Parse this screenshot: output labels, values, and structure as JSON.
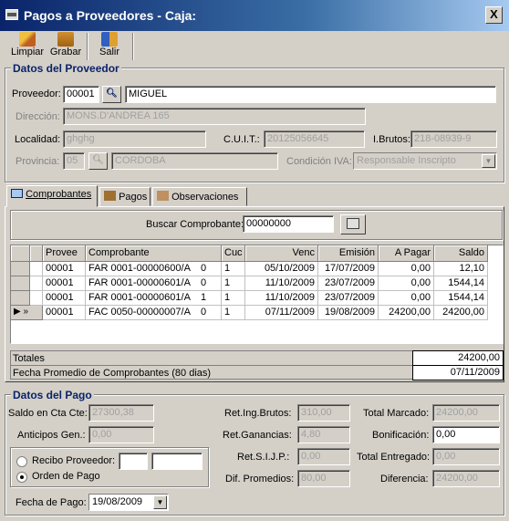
{
  "window": {
    "title": "Pagos a Proveedores - Caja:",
    "close": "X"
  },
  "toolbar": {
    "limpiar": "Limpiar",
    "grabar": "Grabar",
    "salir": "Salir"
  },
  "proveedor": {
    "legend": "Datos del Proveedor",
    "proveedor_label": "Proveedor:",
    "codigo": "00001",
    "nombre": "MIGUEL",
    "direccion_label": "Dirección:",
    "direccion": "MONS.D'ANDREA 165",
    "localidad_label": "Localidad:",
    "localidad": "ghghg",
    "cuit_label": "C.U.I.T.:",
    "cuit": "20125056645",
    "ibrutos_label": "I.Brutos:",
    "ibrutos": "218-08939-9",
    "provincia_label": "Provincia:",
    "provincia_cod": "05",
    "provincia": "CORDOBA",
    "condicion_label": "Condición IVA:",
    "condicion": "Responsable Inscripto"
  },
  "tabs": [
    "Comprobantes",
    "Pagos",
    "Observaciones"
  ],
  "buscar": {
    "label": "Buscar Comprobante:",
    "value": "00000000"
  },
  "grid": {
    "headers": [
      "Provee",
      "Comprobante",
      "Cuc",
      "Venc",
      "Emisión",
      "A Pagar",
      "Saldo"
    ],
    "rows": [
      {
        "indicator": "",
        "provee": "00001",
        "comprobante": "FAR 0001-00000600/A",
        "flag": "0",
        "cuc": "1",
        "venc": "05/10/2009",
        "emision": "17/07/2009",
        "apagar": "0,00",
        "saldo": "12,10"
      },
      {
        "indicator": "",
        "provee": "00001",
        "comprobante": "FAR 0001-00000601/A",
        "flag": "0",
        "cuc": "1",
        "venc": "11/10/2009",
        "emision": "23/07/2009",
        "apagar": "0,00",
        "saldo": "1544,14"
      },
      {
        "indicator": "",
        "provee": "00001",
        "comprobante": "FAR 0001-00000601/A",
        "flag": "1",
        "cuc": "1",
        "venc": "11/10/2009",
        "emision": "23/07/2009",
        "apagar": "0,00",
        "saldo": "1544,14"
      },
      {
        "indicator": "▶ »",
        "provee": "00001",
        "comprobante": "FAC 0050-00000007/A",
        "flag": "0",
        "cuc": "1",
        "venc": "07/11/2009",
        "emision": "19/08/2009",
        "apagar": "24200,00",
        "saldo": "24200,00"
      }
    ]
  },
  "totales": {
    "label": "Totales",
    "value": "24200,00",
    "fecha_label": "Fecha Promedio de Comprobantes (80 dias)",
    "fecha_value": "07/11/2009"
  },
  "pago": {
    "legend": "Datos del Pago",
    "saldo_label": "Saldo en Cta Cte:",
    "saldo": "27300,38",
    "anticipos_label": "Anticipos Gen.:",
    "anticipos": "0,00",
    "recibo_label": "Recibo Proveedor:",
    "orden_label": "Orden de Pago",
    "fecha_label": "Fecha de Pago:",
    "fecha": "19/08/2009",
    "ret_ib_label": "Ret.Ing.Brutos:",
    "ret_ib": "310,00",
    "ret_gan_label": "Ret.Ganancias:",
    "ret_gan": "4,80",
    "ret_sijp_label": "Ret.S.I.J.P.:",
    "ret_sijp": "0,00",
    "dif_label": "Dif. Promedios:",
    "dif": "80,00",
    "total_marcado_label": "Total Marcado:",
    "total_marcado": "24200,00",
    "bonificacion_label": "Bonificación:",
    "bonificacion": "0,00",
    "total_entregado_label": "Total Entregado:",
    "total_entregado": "0,00",
    "diferencia_label": "Diferencia:",
    "diferencia": "24200,00"
  }
}
